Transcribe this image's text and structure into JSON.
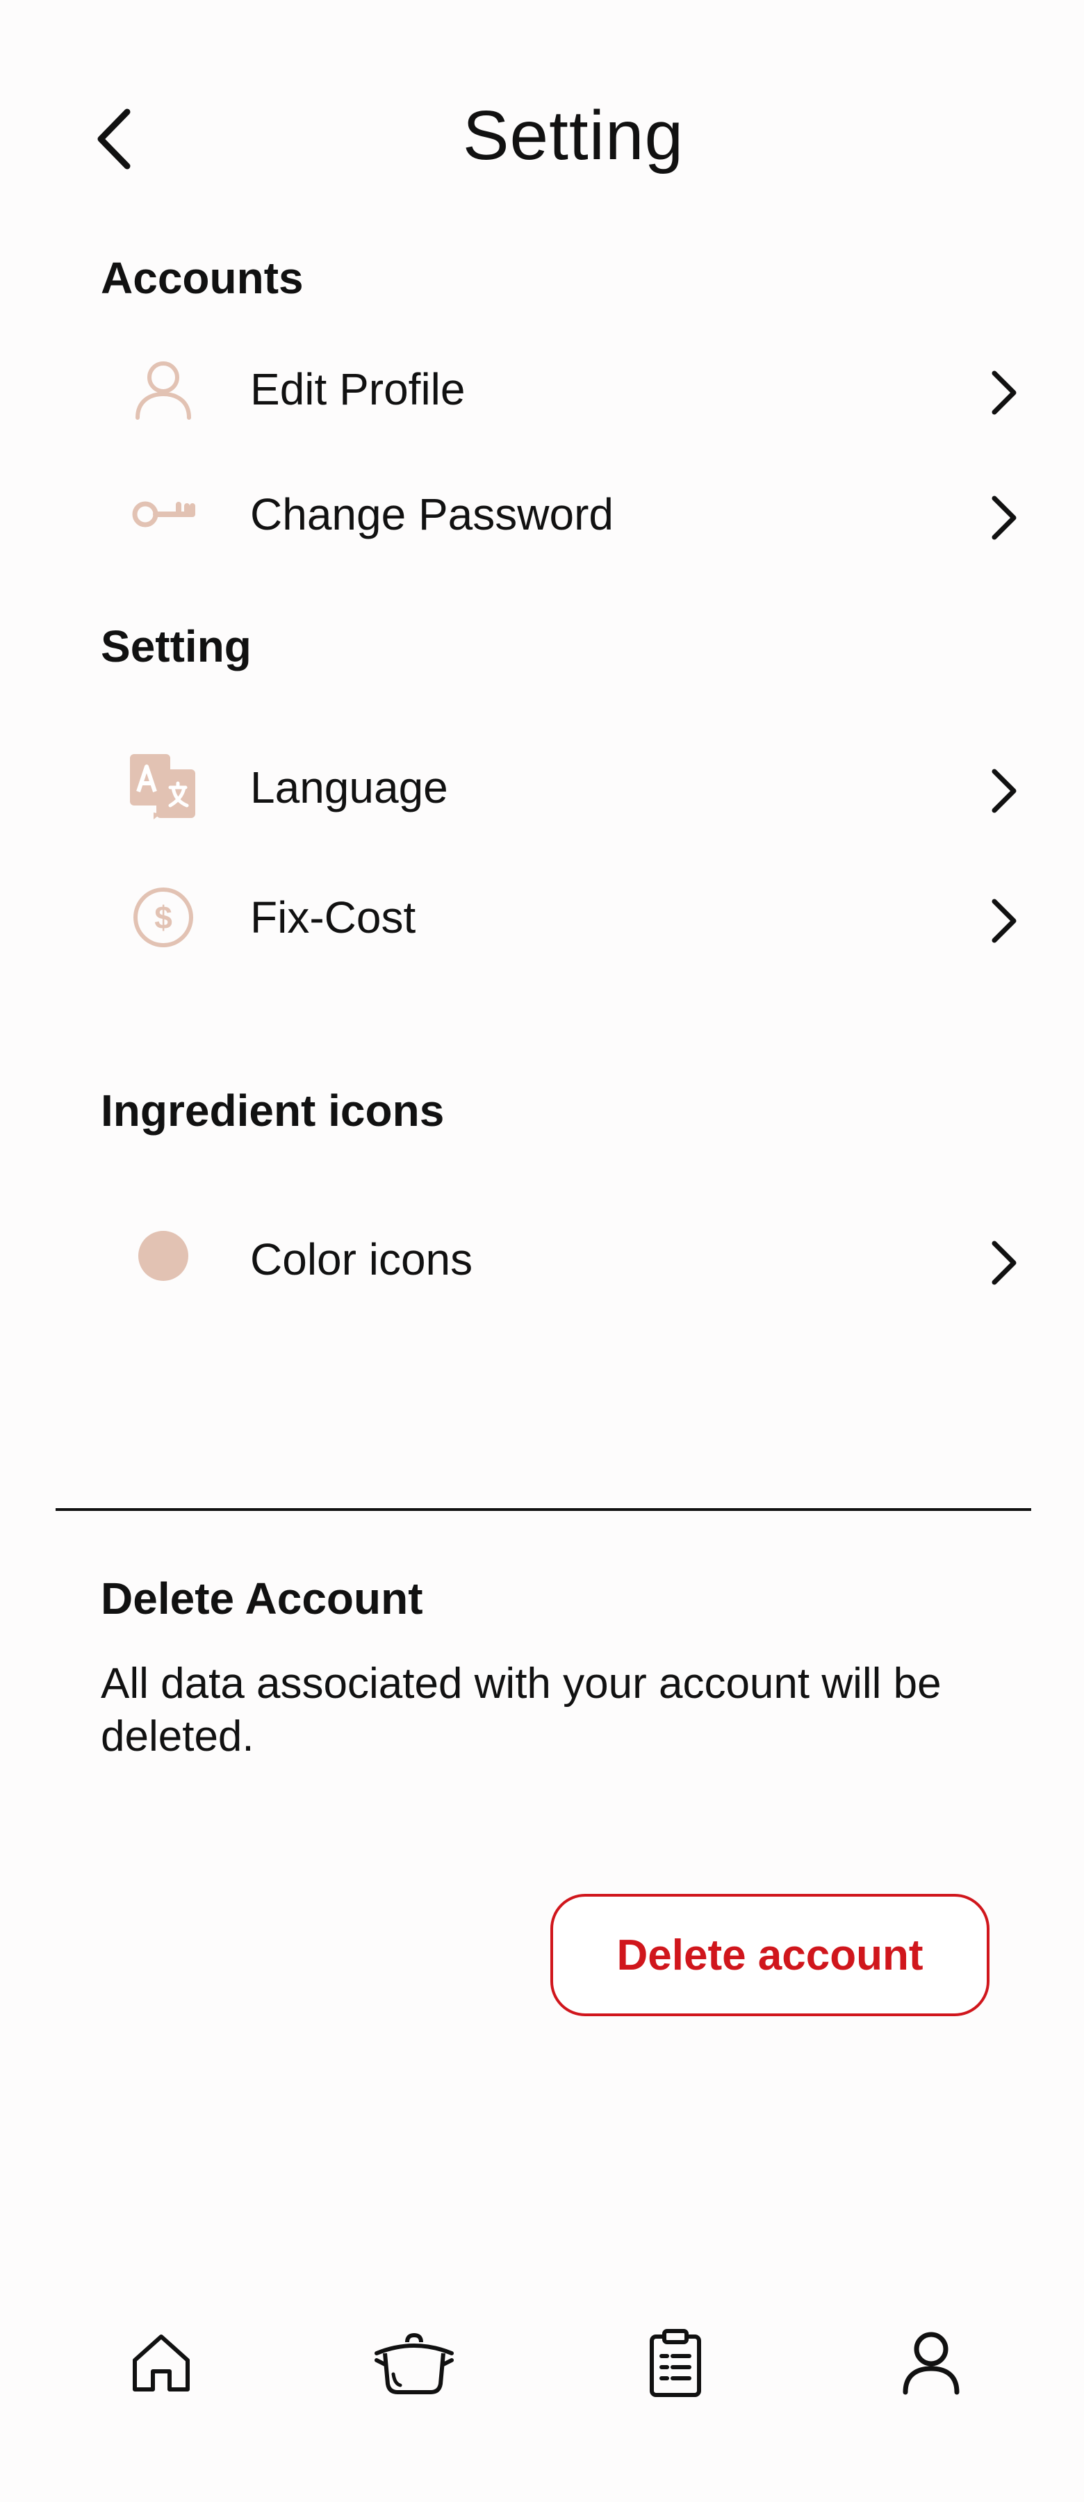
{
  "header": {
    "title": "Setting",
    "back_icon": "chevron-left-icon"
  },
  "sections": {
    "accounts": {
      "title": "Accounts",
      "items": [
        {
          "label": "Edit Profile",
          "icon": "user-icon"
        },
        {
          "label": "Change Password",
          "icon": "key-icon"
        }
      ]
    },
    "setting": {
      "title": "Setting",
      "items": [
        {
          "label": "Language",
          "icon": "translate-icon"
        },
        {
          "label": "Fix-Cost",
          "icon": "dollar-icon"
        }
      ]
    },
    "ingredient_icons": {
      "title": "Ingredient icons",
      "items": [
        {
          "label": "Color icons",
          "icon": "color-dot-icon"
        }
      ]
    }
  },
  "delete": {
    "title": "Delete Account",
    "description": "All data associated with your account will be deleted.",
    "button_label": "Delete account"
  },
  "bottom_nav": [
    {
      "icon": "home-icon"
    },
    {
      "icon": "pot-icon"
    },
    {
      "icon": "clipboard-icon"
    },
    {
      "icon": "profile-icon"
    }
  ],
  "colors": {
    "accent_icon": "#e2c2b3",
    "danger": "#d0161c",
    "text": "#111111",
    "background": "#fdfcfc"
  }
}
